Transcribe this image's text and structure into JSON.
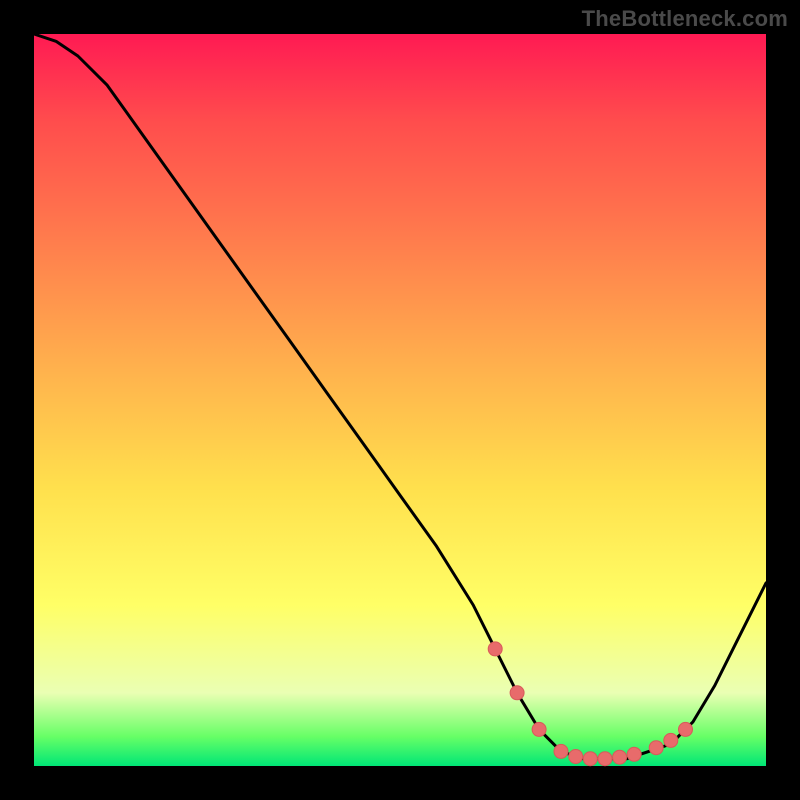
{
  "watermark": "TheBottleneck.com",
  "colors": {
    "curve_stroke": "#000000",
    "marker_fill": "#e86b6b",
    "marker_stroke": "#d85a5a"
  },
  "chart_data": {
    "type": "line",
    "title": "",
    "xlabel": "",
    "ylabel": "",
    "xlim": [
      0,
      100
    ],
    "ylim": [
      0,
      100
    ],
    "grid": false,
    "series": [
      {
        "name": "bottleneck-curve",
        "x": [
          0,
          3,
          6,
          10,
          15,
          20,
          25,
          30,
          35,
          40,
          45,
          50,
          55,
          60,
          63,
          66,
          69,
          72,
          75,
          78,
          81,
          84,
          87,
          90,
          93,
          96,
          100
        ],
        "y": [
          100,
          99,
          97,
          93,
          86,
          79,
          72,
          65,
          58,
          51,
          44,
          37,
          30,
          22,
          16,
          10,
          5,
          2,
          1,
          1,
          1,
          2,
          3,
          6,
          11,
          17,
          25
        ]
      }
    ],
    "markers": {
      "name": "highlight-dots",
      "x": [
        63,
        66,
        69,
        72,
        74,
        76,
        78,
        80,
        82,
        85,
        87,
        89
      ],
      "y": [
        16,
        10,
        5,
        2,
        1.3,
        1,
        1,
        1.2,
        1.6,
        2.5,
        3.5,
        5
      ]
    }
  }
}
